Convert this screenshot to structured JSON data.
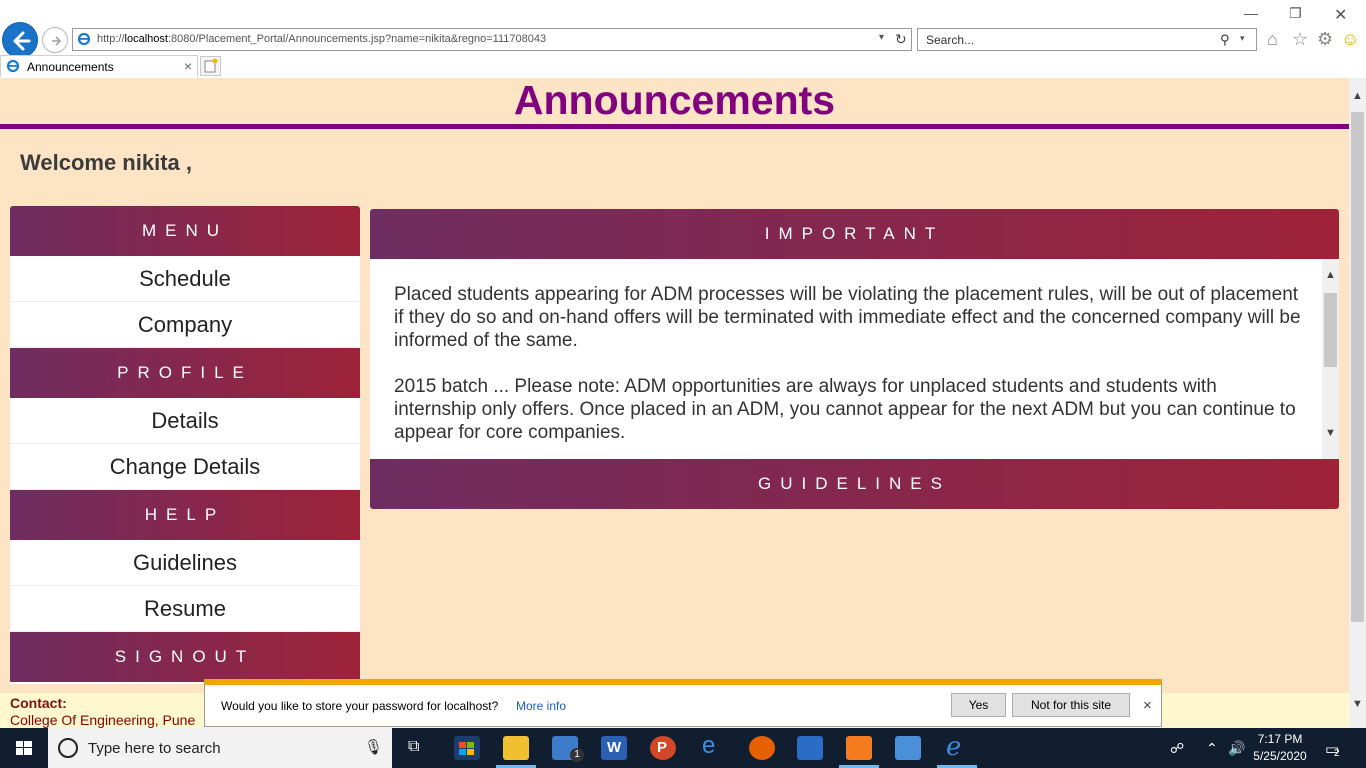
{
  "browser": {
    "url_prefix": "http://",
    "url_host": "localhost",
    "url_rest": ":8080/Placement_Portal/Announcements.jsp?name=nikita&regno=111708043",
    "search_placeholder": "Search...",
    "tab_title": "Announcements"
  },
  "page": {
    "title": "Announcements",
    "welcome": "Welcome nikita ,"
  },
  "menu": {
    "heading_menu": "MENU",
    "schedule": "Schedule",
    "company": "Company",
    "heading_profile": "PROFILE",
    "details": "Details",
    "change_details": "Change Details",
    "heading_help": "HELP",
    "guidelines": "Guidelines",
    "resume": "Resume",
    "signout": "SIGNOUT"
  },
  "important": {
    "heading": "IMPORTANT",
    "announcements": [
      "Placed students appearing for ADM processes will be violating the placement rules, will be out of placement if they do so and on-hand offers will be terminated with immediate effect and the concerned company will be informed of the same.",
      "2015 batch ... Please note: ADM opportunities are always for unplaced students and students with internship only offers. Once placed in an ADM, you cannot appear for the next ADM but you can continue to appear for core companies."
    ]
  },
  "guidelines_panel": {
    "heading": "GUIDELINES"
  },
  "contact": {
    "label": "Contact:",
    "text": "College Of Engineering, Pune"
  },
  "password_bar": {
    "message": "Would you like to store your password for localhost?",
    "more_info": "More info",
    "yes": "Yes",
    "not_for_site": "Not for this site"
  },
  "taskbar": {
    "search_placeholder": "Type here to search",
    "time": "7:17 PM",
    "date": "5/25/2020",
    "mail_badge": "1",
    "notification_count": "2"
  },
  "colors": {
    "page_bg": "#fde4c5",
    "title": "#800080",
    "header_gradient_start": "#6e2d61",
    "header_gradient_end": "#9e2238",
    "contact_text": "#8b0000"
  }
}
